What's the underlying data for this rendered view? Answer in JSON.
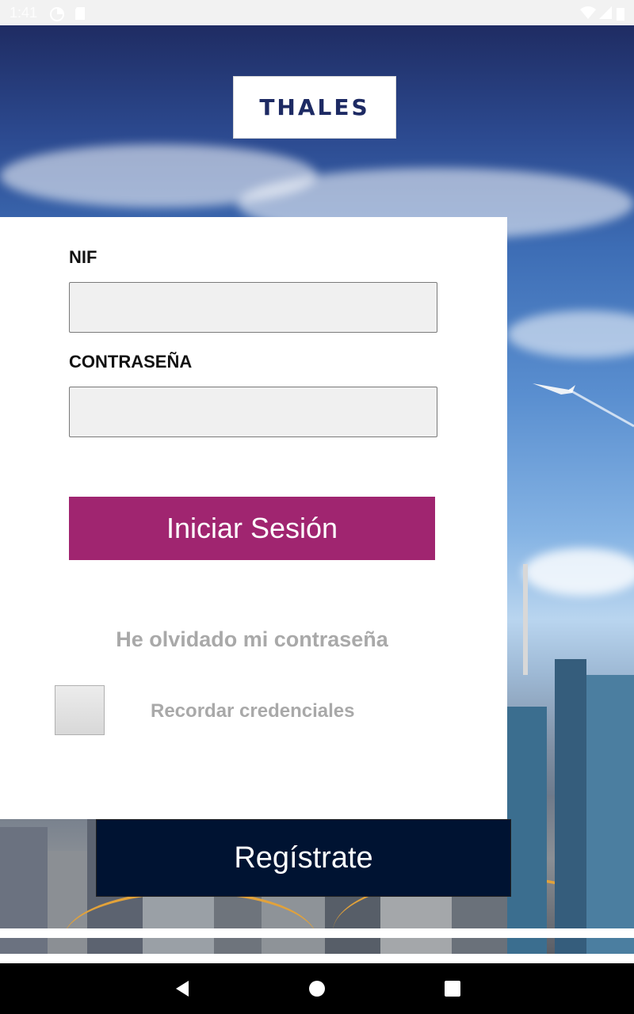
{
  "status_bar": {
    "time": "1:41"
  },
  "brand": {
    "logo_text": "THALES",
    "accent_color": "#a02570",
    "dark_color": "#001332"
  },
  "form": {
    "nif_label": "NIF",
    "nif_value": "",
    "password_label": "CONTRASEÑA",
    "password_value": "",
    "login_button": "Iniciar Sesión",
    "forgot_link": "He olvidado mi contraseña",
    "remember_label": "Recordar credenciales",
    "remember_checked": false
  },
  "register_button": "Regístrate",
  "nav": {
    "back": "back-icon",
    "home": "home-icon",
    "recents": "recents-icon"
  }
}
